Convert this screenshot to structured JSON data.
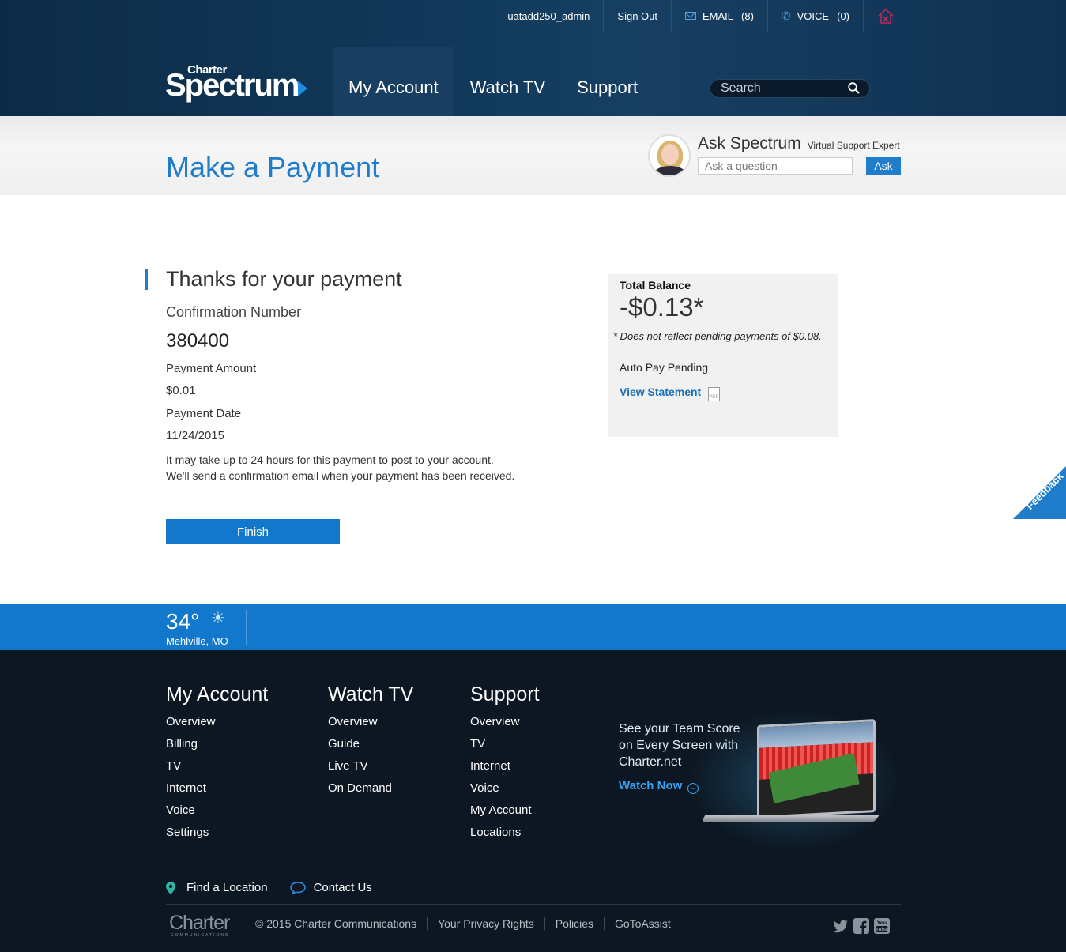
{
  "header": {
    "username": "uatadd250_admin",
    "sign_out": "Sign Out",
    "email_label": "EMAIL",
    "email_count": "(8)",
    "voice_label": "VOICE",
    "voice_count": "(0)",
    "logo_small": "Charter",
    "logo_big": "Spectrum",
    "nav": [
      "My Account",
      "Watch TV",
      "Support"
    ],
    "search_placeholder": "Search"
  },
  "title_band": {
    "title": "Make a Payment",
    "ask_title": "Ask Spectrum",
    "ask_sub": "Virtual Support Expert",
    "ask_placeholder": "Ask a question",
    "ask_button": "Ask"
  },
  "confirmation": {
    "heading": "Thanks for your payment",
    "number_label": "Confirmation Number",
    "number": "380400",
    "amount_label": "Payment Amount",
    "amount": "$0.01",
    "date_label": "Payment Date",
    "date": "11/24/2015",
    "note_line1": "It may take up to 24 hours for this payment to post to your account.",
    "note_line2": "We'll send a confirmation email when your payment has been received.",
    "finish_button": "Finish"
  },
  "balance": {
    "title": "Total Balance",
    "amount": "-$0.13*",
    "note": "* Does not reflect pending payments of $0.08.",
    "autopay": "Auto Pay Pending",
    "view_statement": "View Statement",
    "pdf_label": "PDF"
  },
  "feedback": "Feedback",
  "weather": {
    "temp": "34°",
    "sun": "☀",
    "location": "Mehlville, MO"
  },
  "footer": {
    "columns": [
      {
        "title": "My Account",
        "links": [
          "Overview",
          "Billing",
          "TV",
          "Internet",
          "Voice",
          "Settings"
        ]
      },
      {
        "title": "Watch TV",
        "links": [
          "Overview",
          "Guide",
          "Live TV",
          "On Demand"
        ]
      },
      {
        "title": "Support",
        "links": [
          "Overview",
          "TV",
          "Internet",
          "Voice",
          "My Account",
          "Locations"
        ]
      }
    ],
    "promo_line1": "See your Team Score",
    "promo_line2": "on Every Screen with",
    "promo_line3": "Charter.net",
    "promo_link": "Watch Now",
    "promo_arrow": "→",
    "find_location": "Find a Location",
    "contact_us": "Contact Us",
    "charter_logo": "Charter",
    "charter_logo_sub": "COMMUNICATIONS",
    "legal": [
      "© 2015 Charter Communications",
      "Your Privacy Rights",
      "Policies",
      "GoToAssist"
    ]
  },
  "colors": {
    "accent": "#1f7dcc",
    "header_bg": "#0c2b47",
    "footer_bg": "#0d1723",
    "weather_bg": "#1178cc"
  },
  "icons": [
    "email-icon",
    "phone-icon",
    "home-close-icon",
    "search-icon",
    "pdf-icon",
    "sun-icon",
    "location-pin-icon",
    "chat-icon",
    "twitter-icon",
    "facebook-icon",
    "youtube-icon"
  ]
}
